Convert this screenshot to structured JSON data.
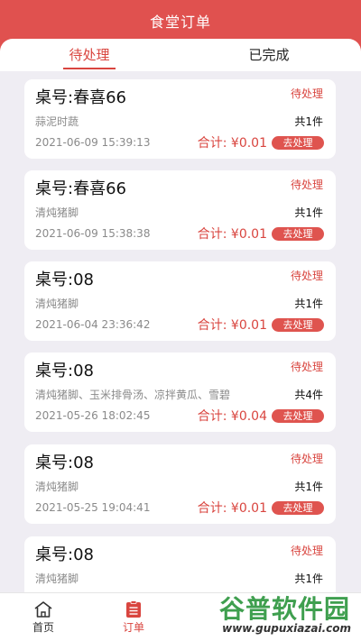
{
  "header": {
    "title": "食堂订单"
  },
  "tabs": {
    "pending": "待处理",
    "done": "已完成"
  },
  "orders": [
    {
      "table": "桌号:春喜66",
      "status": "待处理",
      "dishes": "蒜泥时蔬",
      "count": "共1件",
      "time": "2021-06-09 15:39:13",
      "total": "合计: ¥0.01",
      "action": "去处理"
    },
    {
      "table": "桌号:春喜66",
      "status": "待处理",
      "dishes": "清炖猪脚",
      "count": "共1件",
      "time": "2021-06-09 15:38:38",
      "total": "合计: ¥0.01",
      "action": "去处理"
    },
    {
      "table": "桌号:08",
      "status": "待处理",
      "dishes": "清炖猪脚",
      "count": "共1件",
      "time": "2021-06-04 23:36:42",
      "total": "合计: ¥0.01",
      "action": "去处理"
    },
    {
      "table": "桌号:08",
      "status": "待处理",
      "dishes": "清炖猪脚、玉米排骨汤、凉拌黄瓜、雪碧",
      "count": "共4件",
      "time": "2021-05-26 18:02:45",
      "total": "合计: ¥0.04",
      "action": "去处理"
    },
    {
      "table": "桌号:08",
      "status": "待处理",
      "dishes": "清炖猪脚",
      "count": "共1件",
      "time": "2021-05-25 19:04:41",
      "total": "合计: ¥0.01",
      "action": "去处理"
    },
    {
      "table": "桌号:08",
      "status": "待处理",
      "dishes": "清炖猪脚",
      "count": "共1件",
      "time": "",
      "total": "",
      "action": ""
    }
  ],
  "nav": {
    "home": "首页",
    "orders": "订单"
  },
  "watermark": {
    "brand": "谷普软件园",
    "url": "www.gupuxiazai.com"
  },
  "colors": {
    "accent": "#e0514f",
    "background": "#efedf3"
  }
}
